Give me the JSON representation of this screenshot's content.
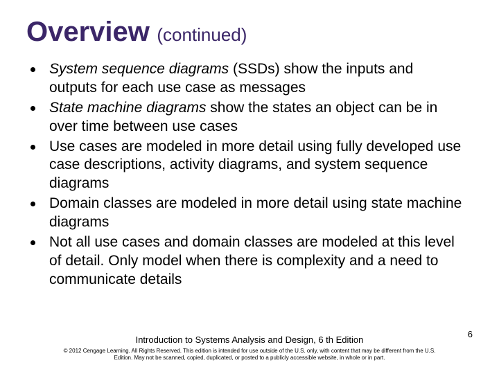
{
  "title": {
    "main": "Overview",
    "sub": "(continued)"
  },
  "bullets": [
    {
      "emph": "System sequence diagrams",
      "rest": " (SSDs) show the inputs and outputs for each use case as messages"
    },
    {
      "emph": "State machine diagrams",
      "rest": " show the states an object can be in over time between use cases"
    },
    {
      "emph": "",
      "rest": "Use cases are modeled in more detail using fully developed use case descriptions, activity diagrams, and system sequence diagrams"
    },
    {
      "emph": "",
      "rest": "Domain classes are modeled in more detail using state machine diagrams"
    },
    {
      "emph": "",
      "rest": "Not all use cases and domain classes are modeled at this level of detail. Only model when there is complexity and a need to communicate details"
    }
  ],
  "footer": {
    "book": "Introduction to Systems Analysis and Design, 6 th Edition",
    "copyright": "© 2012 Cengage Learning. All Rights Reserved. This edition is intended for use outside of the U.S. only, with content that may be different from the U.S. Edition. May not be scanned, copied, duplicated, or posted to a publicly accessible website, in whole or in part."
  },
  "page_number": "6"
}
